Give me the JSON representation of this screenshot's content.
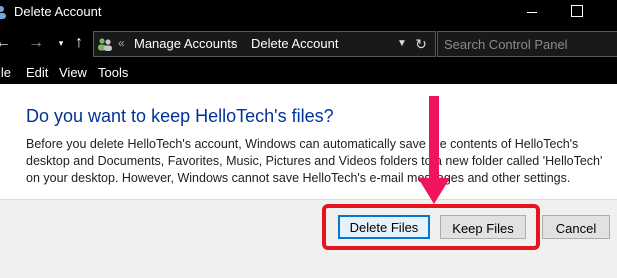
{
  "window": {
    "title": "Delete Account"
  },
  "address": {
    "separator": "«",
    "crumbs": [
      "Manage Accounts",
      "Delete Account"
    ],
    "crumb_arrow": "›"
  },
  "search": {
    "placeholder": "Search Control Panel"
  },
  "menu": [
    "ile",
    "Edit",
    "View",
    "Tools"
  ],
  "content": {
    "question": "Do you want to keep HelloTech's files?",
    "description": "Before you delete HelloTech's account, Windows can automatically save the contents of HelloTech's desktop and Documents, Favorites, Music, Pictures and Videos folders to a new folder called 'HelloTech' on your desktop. However, Windows cannot save HelloTech's e-mail messages and other settings."
  },
  "buttons": {
    "delete_files": "Delete Files",
    "keep_files": "Keep Files",
    "cancel": "Cancel"
  },
  "colors": {
    "heading": "#003399",
    "highlight": "#e5141f",
    "arrow": "#f0145e"
  }
}
